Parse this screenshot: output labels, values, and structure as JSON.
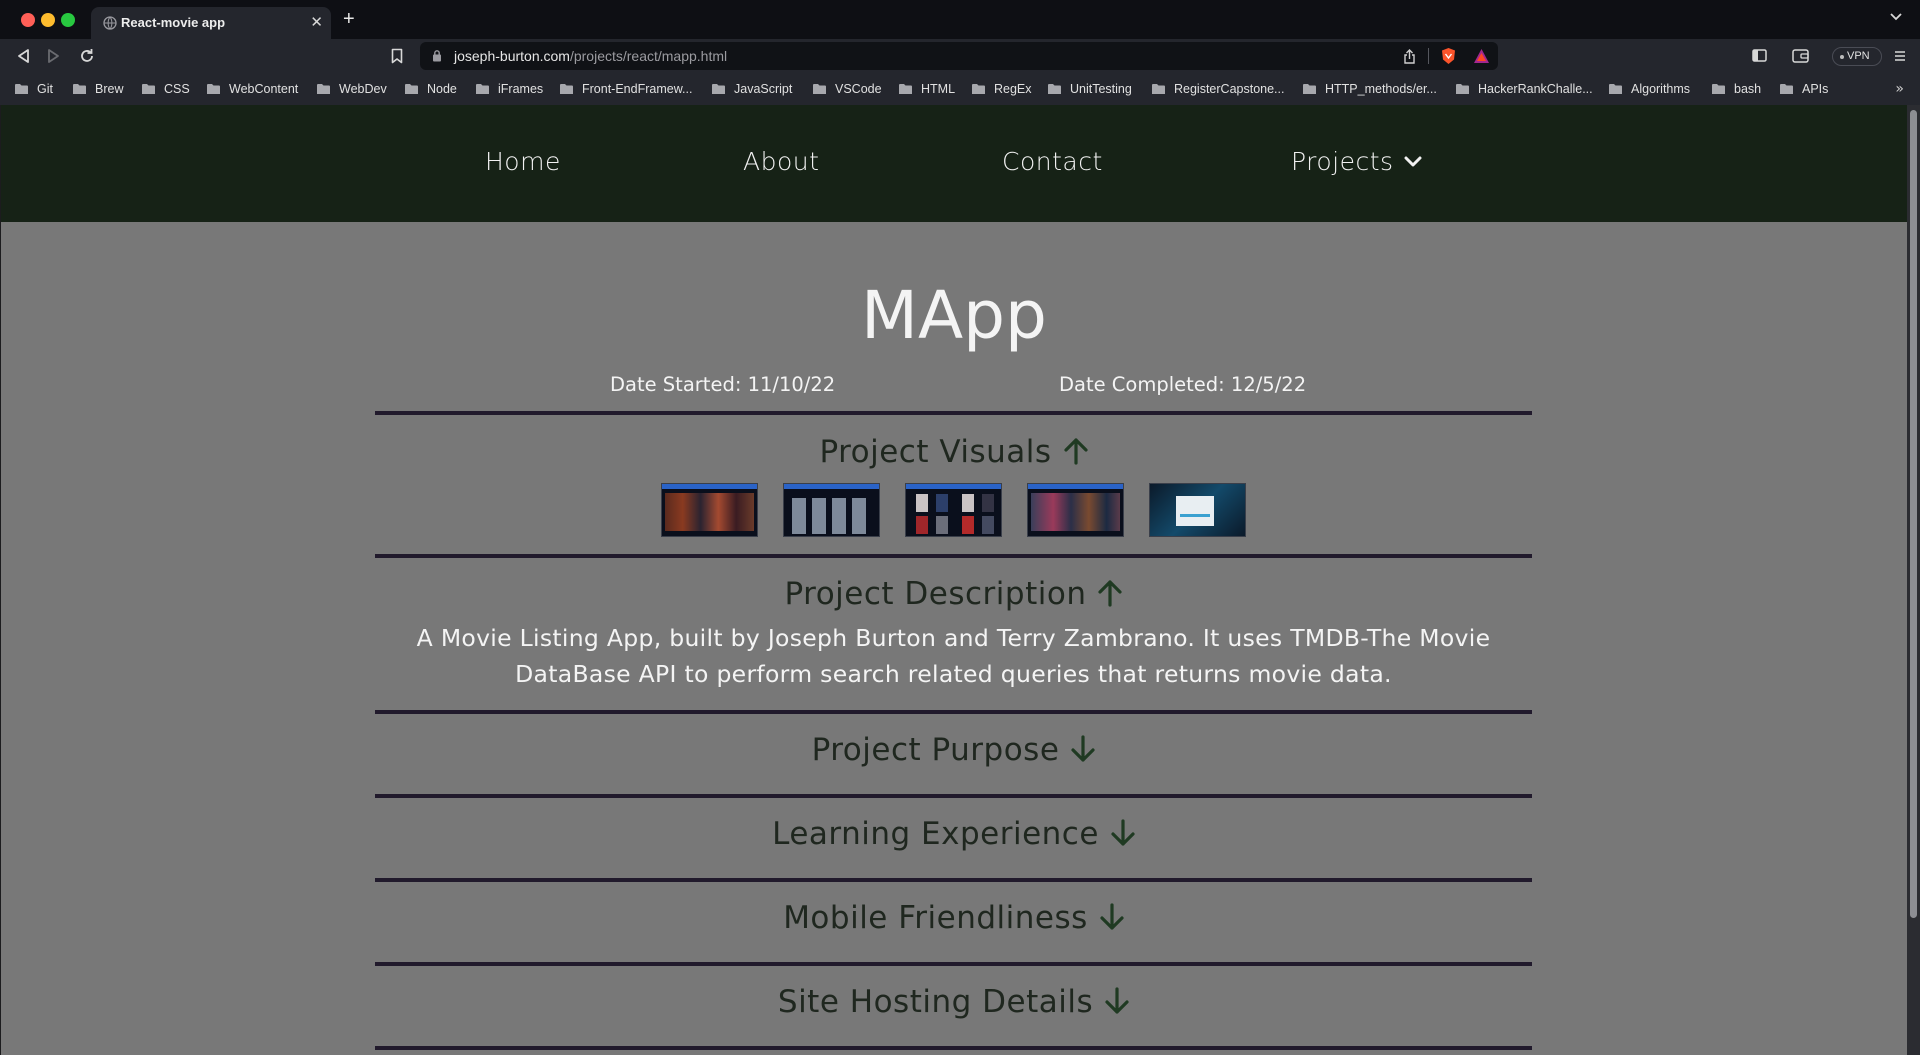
{
  "browser": {
    "tab_title": "React-movie app",
    "url_domain": "joseph-burton.com",
    "url_path": "/projects/react/mapp.html",
    "vpn_label": "VPN",
    "bookmarks": [
      "Git",
      "Brew",
      "CSS",
      "WebContent",
      "WebDev",
      "Node",
      "iFrames",
      "Front-EndFramew...",
      "JavaScript",
      "VSCode",
      "HTML",
      "RegEx",
      "UnitTesting",
      "RegisterCapstone...",
      "HTTP_methods/er...",
      "HackerRankChalle...",
      "Algorithms",
      "bash",
      "APIs"
    ],
    "bookmarks_more": "»"
  },
  "nav": {
    "home": "Home",
    "about": "About",
    "contact": "Contact",
    "projects": "Projects"
  },
  "project": {
    "title": "MApp",
    "date_started": "Date Started: 11/10/22",
    "date_completed": "Date Completed: 12/5/22"
  },
  "sections": {
    "visuals": "Project Visuals",
    "description": "Project Description",
    "description_text": "A Movie Listing App, built by Joseph Burton and Terry Zambrano. It uses TMDB-The Movie DataBase API to perform search related queries that returns movie data.",
    "purpose": "Project Purpose",
    "learning": "Learning Experience",
    "mobile": "Mobile Friendliness",
    "hosting": "Site Hosting Details"
  },
  "colors": {
    "nav_bg": "#162216",
    "page_bg": "#787878",
    "heading": "#1f271f",
    "divider": "#211a2c"
  }
}
